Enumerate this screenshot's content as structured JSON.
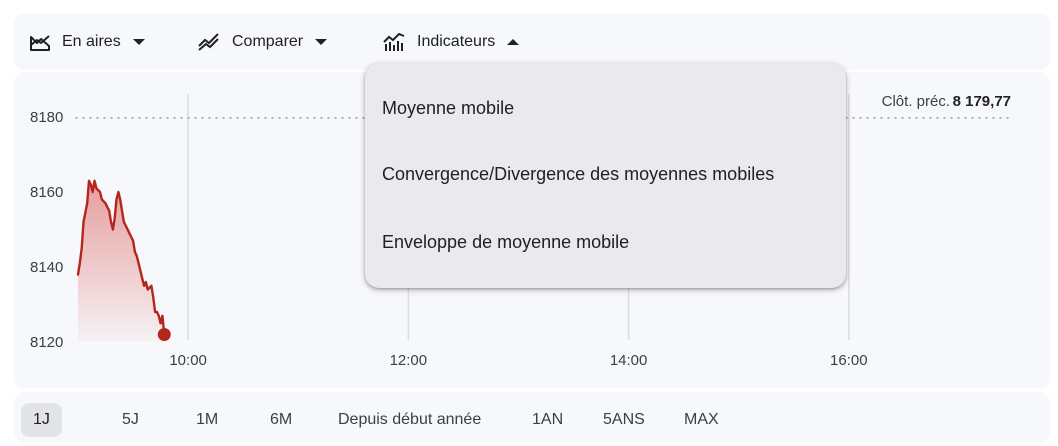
{
  "toolbar": {
    "chart_type": {
      "label": "En aires",
      "icon": "area-chart-icon",
      "caret": "caret-down-icon"
    },
    "compare": {
      "label": "Comparer",
      "icon": "compare-lines-icon",
      "caret": "caret-down-icon"
    },
    "indicators": {
      "label": "Indicateurs",
      "icon": "indicators-chart-icon",
      "caret": "caret-up-icon"
    }
  },
  "dropdown": {
    "items": [
      {
        "label": "Moyenne mobile"
      },
      {
        "label": "Convergence/Divergence des moyennes mobiles"
      },
      {
        "label": "Enveloppe de moyenne mobile"
      }
    ]
  },
  "range": {
    "tabs": [
      {
        "label": "1J",
        "active": true
      },
      {
        "label": "5J",
        "active": false
      },
      {
        "label": "1M",
        "active": false
      },
      {
        "label": "6M",
        "active": false
      },
      {
        "label": "Depuis début année",
        "active": false
      },
      {
        "label": "1AN",
        "active": false
      },
      {
        "label": "5ANS",
        "active": false
      },
      {
        "label": "MAX",
        "active": false
      }
    ]
  },
  "colors": {
    "line": "#b3261e",
    "area": "#e89a96",
    "grid": "#dadce0",
    "dotted": "#9aa0a6",
    "text": "#202124"
  },
  "chart_data": {
    "type": "area",
    "prev_close": {
      "label": "Clôt. préc.",
      "value_text": "8 179,77",
      "value": 8179.77
    },
    "y_ticks": [
      {
        "value": 8180,
        "label": "8180"
      },
      {
        "value": 8160,
        "label": "8160"
      },
      {
        "value": 8140,
        "label": "8140"
      },
      {
        "value": 8120,
        "label": "8120"
      }
    ],
    "x_ticks": [
      {
        "value": "10:00",
        "label": "10:00"
      },
      {
        "value": "12:00",
        "label": "12:00"
      },
      {
        "value": "14:00",
        "label": "14:00"
      },
      {
        "value": "16:00",
        "label": "16:00"
      }
    ],
    "x_range": [
      "09:00",
      "17:30"
    ],
    "ylim": [
      8120,
      8180
    ],
    "grid": "vertical",
    "series": [
      {
        "points": [
          [
            "09:00",
            8138
          ],
          [
            "09:01",
            8141
          ],
          [
            "09:02",
            8145
          ],
          [
            "09:03",
            8152
          ],
          [
            "09:05",
            8157
          ],
          [
            "09:06",
            8163
          ],
          [
            "09:07",
            8162
          ],
          [
            "09:08",
            8160
          ],
          [
            "09:09",
            8163
          ],
          [
            "09:10",
            8161
          ],
          [
            "09:12",
            8160
          ],
          [
            "09:13",
            8158
          ],
          [
            "09:15",
            8157
          ],
          [
            "09:17",
            8155
          ],
          [
            "09:18",
            8152
          ],
          [
            "09:19",
            8150
          ],
          [
            "09:20",
            8153
          ],
          [
            "09:21",
            8158
          ],
          [
            "09:22",
            8160
          ],
          [
            "09:23",
            8158
          ],
          [
            "09:24",
            8155
          ],
          [
            "09:25",
            8152
          ],
          [
            "09:27",
            8150
          ],
          [
            "09:29",
            8148
          ],
          [
            "09:30",
            8147
          ],
          [
            "09:31",
            8144
          ],
          [
            "09:32",
            8143
          ],
          [
            "09:33",
            8141
          ],
          [
            "09:34",
            8139
          ],
          [
            "09:35",
            8137
          ],
          [
            "09:36",
            8135
          ],
          [
            "09:37",
            8136
          ],
          [
            "09:38",
            8134
          ],
          [
            "09:40",
            8135
          ],
          [
            "09:41",
            8132
          ],
          [
            "09:42",
            8128
          ],
          [
            "09:43",
            8128
          ],
          [
            "09:44",
            8127
          ],
          [
            "09:45",
            8125
          ],
          [
            "09:46",
            8127
          ],
          [
            "09:47",
            8122
          ]
        ],
        "last": [
          "09:47",
          8122
        ]
      }
    ]
  }
}
